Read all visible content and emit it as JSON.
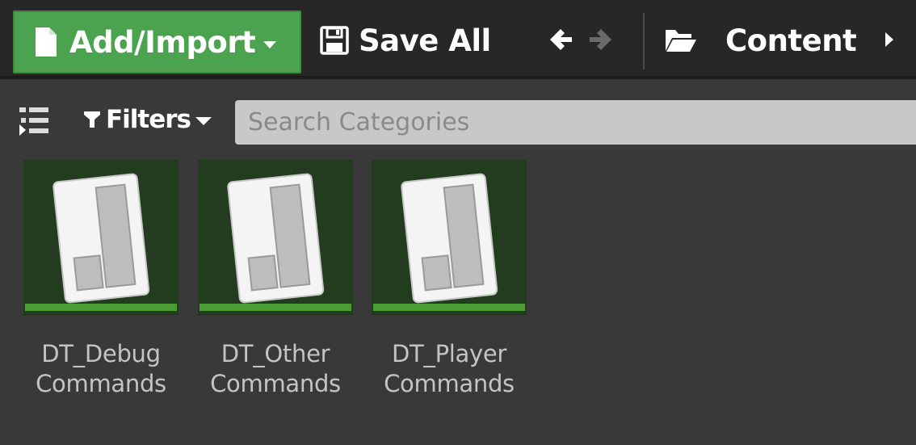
{
  "toolbar": {
    "add_import_label": "Add/Import",
    "save_all_label": "Save All",
    "breadcrumb_label": "Content"
  },
  "filter_bar": {
    "filters_label": "Filters",
    "search_placeholder": "Search Categories"
  },
  "assets": [
    {
      "line1": "DT_Debug",
      "line2": "Commands"
    },
    {
      "line1": "DT_Other",
      "line2": "Commands"
    },
    {
      "line1": "DT_Player",
      "line2": "Commands"
    }
  ],
  "colors": {
    "add_import_green": "#4ca34f",
    "thumbnail_bg": "#233b1f",
    "data_table_type_bar": "#4a9d34",
    "panel_bg": "#393939",
    "toolbar_bg": "#272727"
  },
  "icons": {
    "add_import": "new-file-icon",
    "save_all": "floppy-disk-icon",
    "back": "arrow-left-icon",
    "forward": "arrow-right-icon",
    "breadcrumb": "folder-open-icon",
    "breadcrumb_next": "chevron-right-icon",
    "sources_toggle": "tree-list-icon",
    "filters": "funnel-icon",
    "asset": "data-table-icon"
  }
}
